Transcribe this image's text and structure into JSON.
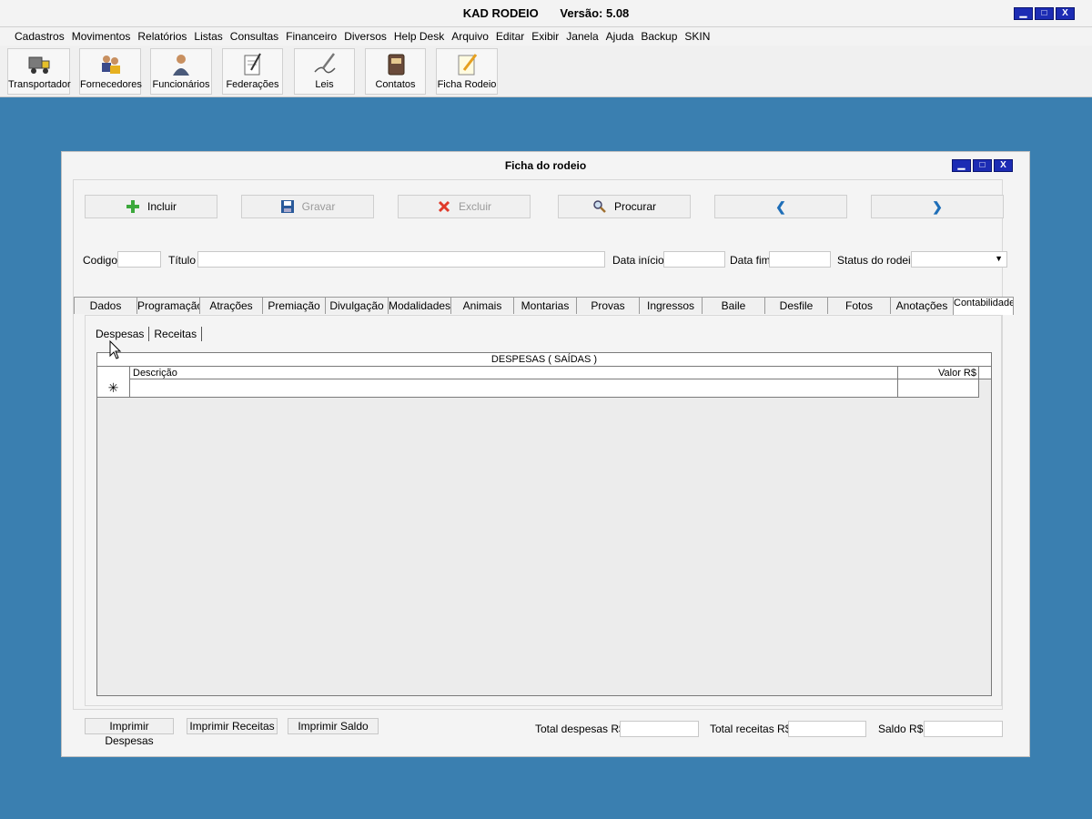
{
  "app": {
    "name": "KAD RODEIO",
    "version": "Versão: 5.08"
  },
  "menu": [
    "Cadastros",
    "Movimentos",
    "Relatórios",
    "Listas",
    "Consultas",
    "Financeiro",
    "Diversos",
    "Help Desk",
    "Arquivo",
    "Editar",
    "Exibir",
    "Janela",
    "Ajuda",
    "Backup",
    "SKIN"
  ],
  "toolbar": {
    "transportador": "Transportador",
    "fornecedores": "Fornecedores",
    "funcionarios": "Funcionários",
    "federacoes": "Federações",
    "leis": "Leis",
    "contatos": "Contatos",
    "ficha_rodeio": "Ficha Rodeio"
  },
  "window": {
    "title": "Ficha do rodeio",
    "min": "▁",
    "max": "□",
    "close": "X"
  },
  "actions": {
    "incluir": "Incluir",
    "gravar": "Gravar",
    "excluir": "Excluir",
    "procurar": "Procurar",
    "prev": "❮",
    "next": "❯"
  },
  "fields": {
    "codigo_label": "Codigo",
    "codigo_value": "",
    "titulo_label": "Título",
    "titulo_value": "",
    "data_inicio_label": "Data início",
    "data_inicio_value": "",
    "data_fim_label": "Data fim",
    "data_fim_value": "",
    "status_label": "Status do rodeio",
    "status_value": ""
  },
  "tabs": [
    "Dados",
    "Programação",
    "Atrações",
    "Premiação",
    "Divulgação",
    "Modalidades",
    "Animais",
    "Montarias",
    "Provas",
    "Ingressos",
    "Baile",
    "Desfile",
    "Fotos",
    "Anotações",
    "Contabilidade"
  ],
  "active_tab": "Contabilidade",
  "subtabs": [
    "Despesas",
    "Receitas"
  ],
  "grid": {
    "caption": "DESPESAS ( SAÍDAS )",
    "col_desc": "Descrição",
    "col_valor": "Valor R$",
    "new_row_marker": "✳",
    "rows": []
  },
  "footer": {
    "imprimir_despesas": "Imprimir Despesas",
    "imprimir_receitas": "Imprimir Receitas",
    "imprimir_saldo": "Imprimir Saldo",
    "total_despesas_label": "Total despesas R$",
    "total_despesas_value": "",
    "total_receitas_label": "Total receitas R$",
    "total_receitas_value": "",
    "saldo_label": "Saldo R$",
    "saldo_value": ""
  },
  "colors": {
    "desktop": "#3a7fb0",
    "window_button": "#1c2cb4",
    "incluir_icon": "#3ca83c",
    "excluir_icon": "#e03a2a",
    "arrow": "#1e6eb8"
  }
}
